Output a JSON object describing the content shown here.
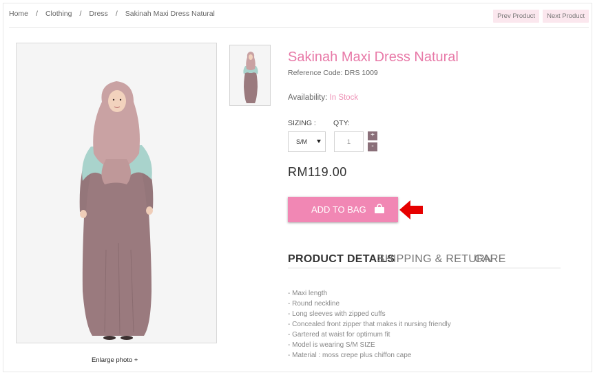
{
  "breadcrumb": {
    "items": [
      "Home",
      "Clothing",
      "Dress",
      "Sakinah Maxi Dress Natural"
    ],
    "separator": "/"
  },
  "nav": {
    "prev_label": "Prev Product",
    "next_label": "Next Product"
  },
  "product": {
    "title": "Sakinah Maxi Dress Natural",
    "reference": "Reference Code: DRS 1009",
    "availability_label": "Availability:",
    "availability_value": "In Stock",
    "sizing_label": "SIZING :",
    "qty_label": "QTY:",
    "size_selected": "S/M",
    "qty_value": "1",
    "qty_plus": "+",
    "qty_minus": "-",
    "price": "RM119.00",
    "add_to_bag_label": "ADD TO BAG",
    "enlarge_label": "Enlarge photo +"
  },
  "tabs": [
    "PRODUCT DETAILS",
    "SHIPPING & RETURN",
    "CARE"
  ],
  "details": [
    "- Maxi length",
    "- Round neckline",
    "- Long sleeves with zipped cuffs",
    "- Concealed front zipper that makes it nursing friendly",
    "- Gartered at waist for optimum fit",
    "- Model is wearing S/M SIZE",
    "- Material : moss crepe plus chiffon cape"
  ],
  "colors": {
    "accent_pink": "#e87aa8",
    "button_pink": "#f187b4",
    "dress_mauve": "#9a7a7e",
    "hijab_pink": "#c9a2a3",
    "cape_mint": "#a9d3cc",
    "arrow_red": "#e60000"
  },
  "icons": {
    "bag": "bag-icon",
    "arrow": "red-arrow-icon",
    "caret": "caret-down-icon"
  }
}
